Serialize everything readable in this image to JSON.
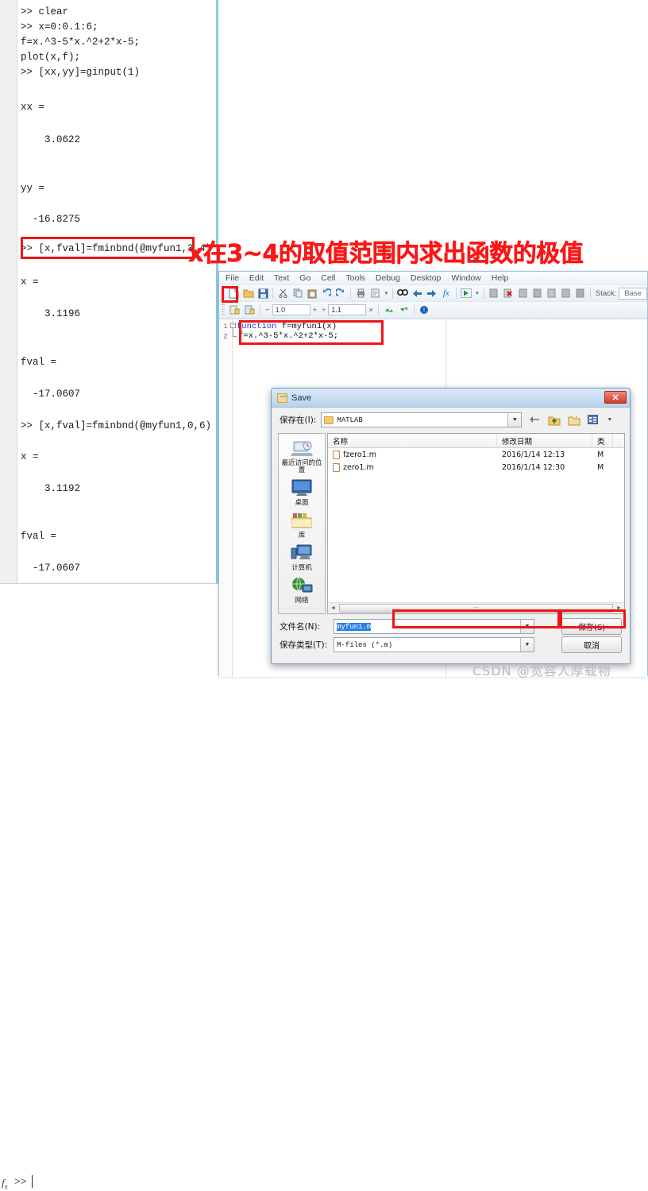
{
  "command_window": {
    "lines": [
      ">> clear",
      ">> x=0:0.1:6;",
      "f=x.^3-5*x.^2+2*x-5;",
      "plot(x,f);",
      ">> [xx,yy]=ginput(1)",
      "xx =",
      "    3.0622",
      "yy =",
      "  -16.8275",
      ">> [x,fval]=fminbnd(@myfun1,3,4)",
      "x =",
      "    3.1196",
      "fval =",
      "  -17.0607",
      ">> [x,fval]=fminbnd(@myfun1,0,6)",
      "x =",
      "    3.1192",
      "fval =",
      "  -17.0607"
    ],
    "prompt": ">>",
    "fx_label": "fx"
  },
  "annotation": {
    "red_text": "x在3~4的取值范围内求出函数的极值",
    "highlighted_command": ">> [x,fval]=fminbnd(@myfun1,3,4)"
  },
  "editor": {
    "menus": [
      "File",
      "Edit",
      "Text",
      "Go",
      "Cell",
      "Tools",
      "Debug",
      "Desktop",
      "Window",
      "Help"
    ],
    "toolbar_row1_icons": [
      "new-file-icon",
      "open-folder-icon",
      "save-icon",
      "cut-icon",
      "copy-icon",
      "paste-icon",
      "undo-icon",
      "redo-icon",
      "print-icon",
      "print-preview-icon",
      "dropdown-arrow-icon",
      "find-icon",
      "back-arrow-icon",
      "forward-arrow-icon",
      "function-browser-icon",
      "run-icon",
      "run-dropdown-icon",
      "step-icon",
      "stop-debug-icon",
      "step-in-icon",
      "step-out-icon",
      "continue-icon",
      "set-breakpoint-icon",
      "clear-breakpoint-icon"
    ],
    "stack_label": "Stack:",
    "stack_value": "Base",
    "toolbar_row2_icons": [
      "cell-mode-icon",
      "cell-toolbar-icon"
    ],
    "decrement_symbol": "−",
    "field1_value": "1.0",
    "increment_symbol": "+",
    "divide_symbol": "÷",
    "field2_value": "1.1",
    "multiply_symbol": "×",
    "row2_extra_icons": [
      "next-cell-icon",
      "prev-cell-icon",
      "help-icon"
    ],
    "line_numbers": [
      "1",
      "2"
    ],
    "code_line1_keyword": "function",
    "code_line1_rest": " f=myfun1(x)",
    "code_line2": "f=x.^3-5*x.^2+2*x-5;"
  },
  "save_dialog": {
    "title": "Save",
    "close_label": "✕",
    "save_in_label": "保存在(I):",
    "current_folder": "MATLAB",
    "nav_icons": [
      "back-arrow-icon",
      "up-folder-icon",
      "new-folder-icon",
      "view-mode-icon",
      "view-dropdown-icon"
    ],
    "places": [
      {
        "label": "最近访问的位置",
        "icon": "recent-places-icon",
        "color": "#9fb6cc"
      },
      {
        "label": "桌面",
        "icon": "desktop-icon",
        "color": "#3b6ea5"
      },
      {
        "label": "库",
        "icon": "libraries-icon",
        "color": "#f0d27a"
      },
      {
        "label": "计算机",
        "icon": "computer-icon",
        "color": "#4a76ad"
      },
      {
        "label": "网络",
        "icon": "network-icon",
        "color": "#3d8f3d"
      }
    ],
    "columns": [
      "名称",
      "修改日期",
      "类"
    ],
    "files": [
      {
        "name": "fzero1.m",
        "date": "2016/1/14 12:13",
        "type": "M"
      },
      {
        "name": "zero1.m",
        "date": "2016/1/14 12:30",
        "type": "M"
      }
    ],
    "filename_label": "文件名(N):",
    "filename_value": "myfun1.m",
    "filetype_label": "保存类型(T):",
    "filetype_value": "M-files (*.m)",
    "save_button": "保存(S)",
    "cancel_button": "取消",
    "dropdown_arrow": "▼",
    "scroll_left_arrow": "◄",
    "scroll_right_arrow": "►",
    "scroll_grip": "⋯"
  },
  "watermark": "CSDN @宽容人厚载物",
  "colors": {
    "annotation_red": "#fc1616",
    "keyword_blue": "#1a38d6",
    "selection_blue": "#2a7fe8",
    "titlebar_blue": "#b8d3ec"
  }
}
